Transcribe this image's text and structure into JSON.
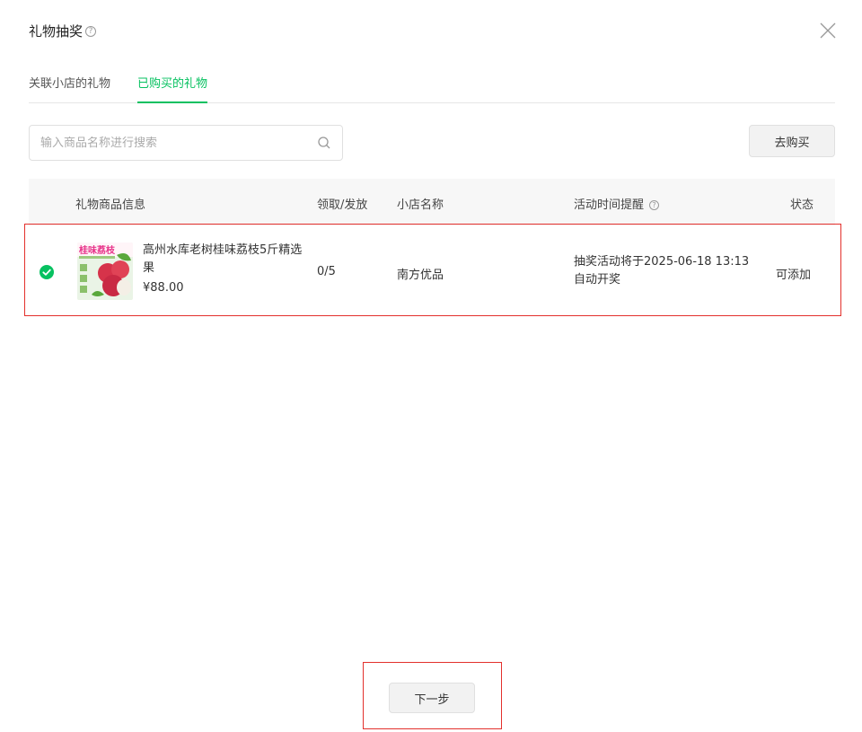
{
  "dialog": {
    "title": "礼物抽奖",
    "help_glyph": "?"
  },
  "tabs": [
    {
      "label": "关联小店的礼物",
      "active": false
    },
    {
      "label": "已购买的礼物",
      "active": true
    }
  ],
  "search": {
    "placeholder": "输入商品名称进行搜索",
    "value": ""
  },
  "buy_button": {
    "label": "去购买"
  },
  "table": {
    "headers": {
      "product": "礼物商品信息",
      "claim": "领取/发放",
      "shop": "小店名称",
      "time": "活动时间提醒",
      "status": "状态"
    },
    "rows": [
      {
        "selected": true,
        "thumb_title": "桂味荔枝",
        "name": "高州水库老树桂味荔枝5斤精选果",
        "price": "¥88.00",
        "claim": "0/5",
        "shop": "南方优品",
        "time_note": "抽奖活动将于2025-06-18 13:13自动开奖",
        "status": "可添加"
      }
    ]
  },
  "next_button": {
    "label": "下一步"
  },
  "colors": {
    "accent": "#07c160",
    "highlight": "#e3302c"
  }
}
